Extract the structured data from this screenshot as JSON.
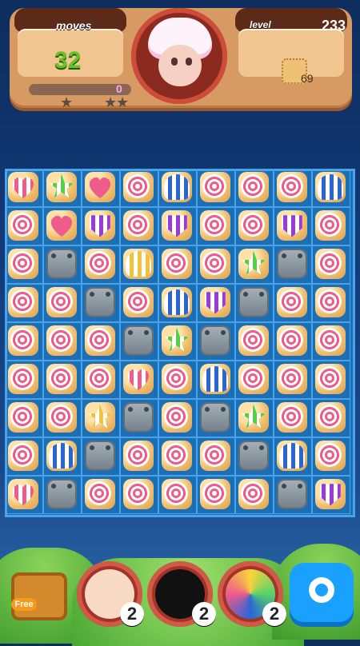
{
  "hud": {
    "moves_label": "moves",
    "moves_value": "32",
    "level_label": "level",
    "level_value": "233",
    "target_count": "69",
    "score_value": "0",
    "progress_fraction": 0
  },
  "board": {
    "rows": 9,
    "cols": 9,
    "cells": [
      [
        "heart-pink",
        "star-green",
        "heart-pink-plain",
        "swirl",
        "dome-blue",
        "swirl",
        "swirl",
        "swirl",
        "dome-blue"
      ],
      [
        "swirl",
        "heart-pink-plain",
        "gem-purple",
        "swirl",
        "gem-purple",
        "swirl",
        "swirl",
        "gem-purple",
        "swirl"
      ],
      [
        "swirl",
        "stone",
        "swirl",
        "dome-yellow",
        "swirl",
        "swirl",
        "star-green",
        "stone",
        "swirl"
      ],
      [
        "swirl",
        "swirl",
        "stone",
        "swirl",
        "dome-blue",
        "gem-purple",
        "stone",
        "swirl",
        "swirl"
      ],
      [
        "swirl",
        "swirl",
        "swirl",
        "stone",
        "star-green",
        "stone",
        "swirl",
        "swirl",
        "swirl"
      ],
      [
        "swirl",
        "swirl",
        "swirl",
        "heart-pink",
        "swirl",
        "dome-blue",
        "swirl",
        "swirl",
        "swirl"
      ],
      [
        "swirl",
        "swirl",
        "star-yellow",
        "stone",
        "swirl",
        "stone",
        "star-green",
        "swirl",
        "swirl"
      ],
      [
        "swirl",
        "dome-blue",
        "stone",
        "swirl",
        "swirl",
        "swirl",
        "stone",
        "dome-blue",
        "swirl"
      ],
      [
        "heart-pink",
        "stone",
        "swirl",
        "swirl",
        "swirl",
        "swirl",
        "swirl",
        "stone",
        "gem-purple"
      ]
    ]
  },
  "boosters": [
    {
      "name": "lollipop",
      "count": "2"
    },
    {
      "name": "bomb",
      "count": "2"
    },
    {
      "name": "rainbow-lollipop",
      "count": "2"
    }
  ],
  "free_label": "Free",
  "colors": {
    "pink": "#ef5b8b",
    "green": "#4fd24a",
    "blue": "#2a65d8",
    "purple": "#9a3ad8",
    "yellow": "#f2c23a"
  },
  "icons": {
    "settings": "gear-icon",
    "stars": "star-icon"
  }
}
